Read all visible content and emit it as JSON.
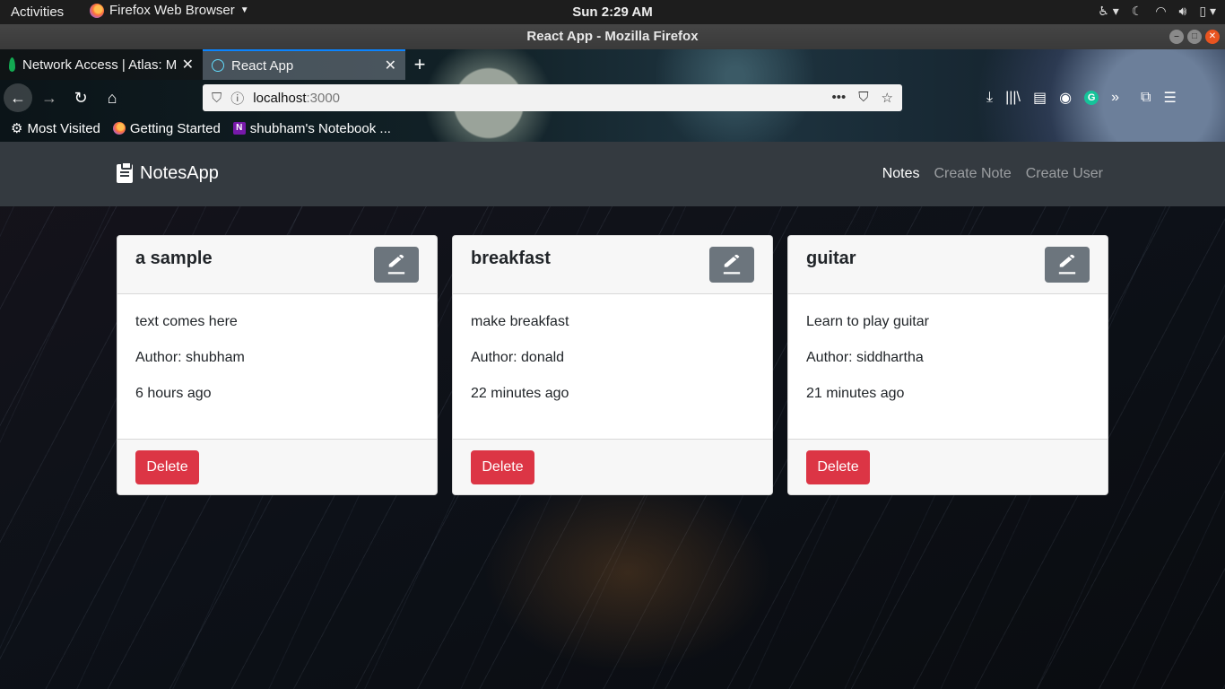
{
  "system": {
    "activities": "Activities",
    "app_menu": "Firefox Web Browser",
    "clock": "Sun  2:29 AM"
  },
  "window": {
    "title": "React App - Mozilla Firefox"
  },
  "browser": {
    "tabs": [
      {
        "title": "Network Access | Atlas: M",
        "icon": "mongodb-leaf-icon",
        "active": false
      },
      {
        "title": "React App",
        "icon": "react-icon",
        "active": true
      }
    ],
    "url_host": "localhost",
    "url_port": ":3000",
    "bookmarks": [
      {
        "label": "Most Visited",
        "icon": "gear-icon"
      },
      {
        "label": "Getting Started",
        "icon": "firefox-icon"
      },
      {
        "label": "shubham's Notebook ...",
        "icon": "onenote-icon"
      }
    ]
  },
  "app": {
    "brand": "NotesApp",
    "nav": {
      "notes": "Notes",
      "create_note": "Create Note",
      "create_user": "Create User"
    },
    "delete_label": "Delete",
    "notes": [
      {
        "title": "a sample",
        "content": "text comes here",
        "author": "Author: shubham",
        "time": "6 hours ago"
      },
      {
        "title": "breakfast",
        "content": "make breakfast",
        "author": "Author: donald",
        "time": "22 minutes ago"
      },
      {
        "title": "guitar",
        "content": "Learn to play guitar",
        "author": "Author: siddhartha",
        "time": "21 minutes ago"
      }
    ]
  },
  "colors": {
    "navbar": "#343a40",
    "danger": "#dc3545",
    "secondary": "#6c757d"
  }
}
